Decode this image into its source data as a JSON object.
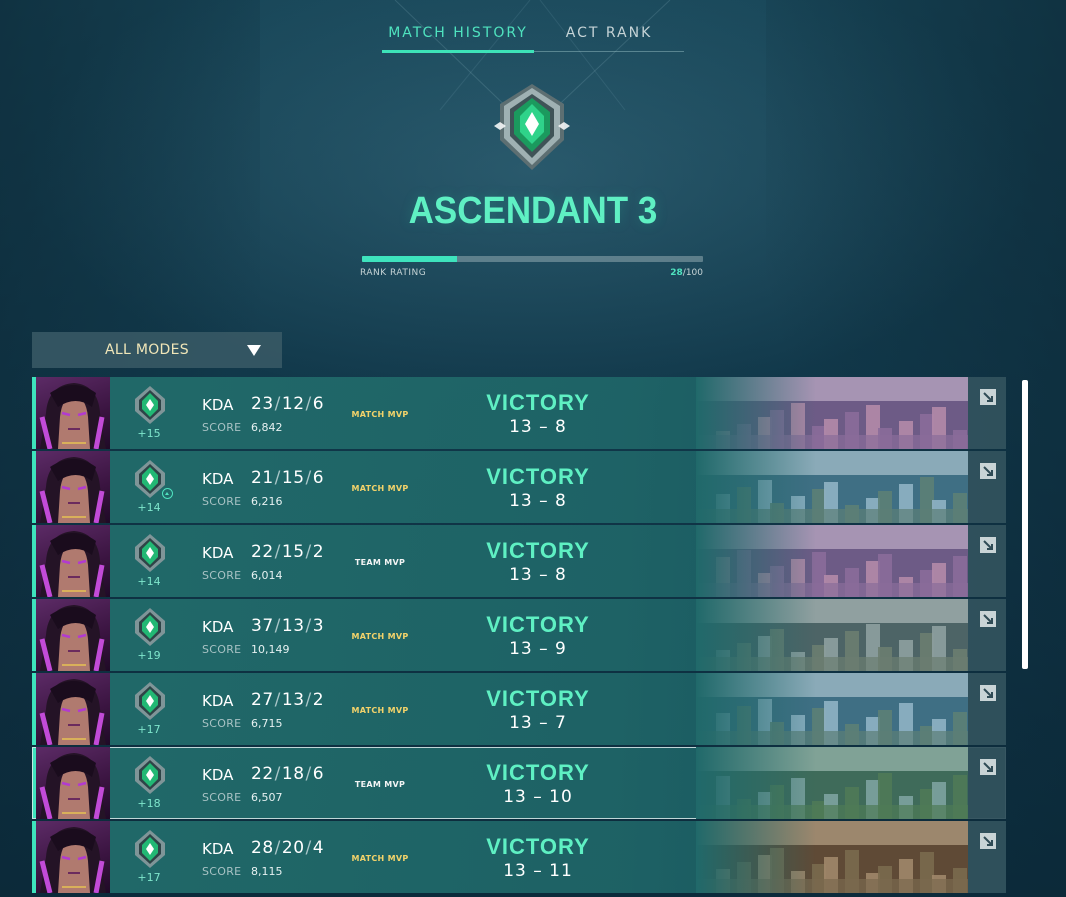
{
  "tabs": [
    {
      "label": "MATCH HISTORY",
      "active": true
    },
    {
      "label": "ACT RANK",
      "active": false
    }
  ],
  "rank": {
    "name": "ASCENDANT 3",
    "rating_label": "RANK RATING",
    "rating_current": "28",
    "rating_max": "/100",
    "rating_fraction": 0.28,
    "emblem_icon": "ascendant-rank-icon"
  },
  "filter": {
    "selected": "ALL MODES"
  },
  "colors": {
    "accent": "#3ee3bd",
    "victory": "#5ff0c3",
    "match_mvp": "#f3d36a",
    "team_mvp": "#f2f4f4"
  },
  "match_labels": {
    "kda": "KDA",
    "score": "SCORE"
  },
  "matches": [
    {
      "rr": "+15",
      "kills": "23",
      "deaths": "12",
      "assists": "6",
      "score": "6,842",
      "mvp": "MATCH MVP",
      "mvp_type": "match",
      "result": "VICTORY",
      "scoreline": "13 – 8",
      "map_theme": "purple",
      "promoted": false,
      "selected": false
    },
    {
      "rr": "+14",
      "kills": "21",
      "deaths": "15",
      "assists": "6",
      "score": "6,216",
      "mvp": "MATCH MVP",
      "mvp_type": "match",
      "result": "VICTORY",
      "scoreline": "13 – 8",
      "map_theme": "blue",
      "promoted": true,
      "selected": false
    },
    {
      "rr": "+14",
      "kills": "22",
      "deaths": "15",
      "assists": "2",
      "score": "6,014",
      "mvp": "TEAM MVP",
      "mvp_type": "team",
      "result": "VICTORY",
      "scoreline": "13 – 8",
      "map_theme": "purple",
      "promoted": false,
      "selected": false
    },
    {
      "rr": "+19",
      "kills": "37",
      "deaths": "13",
      "assists": "3",
      "score": "10,149",
      "mvp": "MATCH MVP",
      "mvp_type": "match",
      "result": "VICTORY",
      "scoreline": "13 – 9",
      "map_theme": "grey",
      "promoted": false,
      "selected": false
    },
    {
      "rr": "+17",
      "kills": "27",
      "deaths": "13",
      "assists": "2",
      "score": "6,715",
      "mvp": "MATCH MVP",
      "mvp_type": "match",
      "result": "VICTORY",
      "scoreline": "13 – 7",
      "map_theme": "blue",
      "promoted": false,
      "selected": false
    },
    {
      "rr": "+18",
      "kills": "22",
      "deaths": "18",
      "assists": "6",
      "score": "6,507",
      "mvp": "TEAM MVP",
      "mvp_type": "team",
      "result": "VICTORY",
      "scoreline": "13 – 10",
      "map_theme": "green",
      "promoted": false,
      "selected": true
    },
    {
      "rr": "+17",
      "kills": "28",
      "deaths": "20",
      "assists": "4",
      "score": "8,115",
      "mvp": "MATCH MVP",
      "mvp_type": "match",
      "result": "VICTORY",
      "scoreline": "13 – 11",
      "map_theme": "brown",
      "promoted": false,
      "selected": false
    }
  ]
}
